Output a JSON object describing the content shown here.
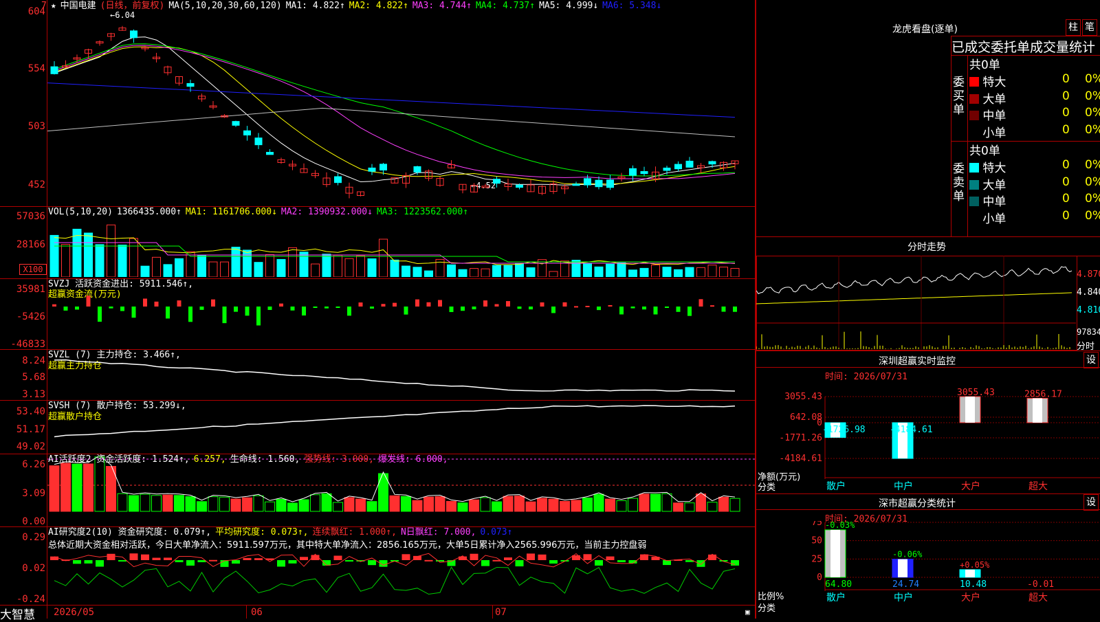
{
  "header": {
    "marker": "7",
    "star": "★",
    "stock_name": "中国电建",
    "period": "(日线，前复权)",
    "ma_label": "MA(5,10,20,30,60,120)",
    "ma1": "MA1: 4.822↑",
    "ma2": "MA2: 4.822↑",
    "ma3": "MA3: 4.744↑",
    "ma4": "MA4: 4.737↑",
    "ma5": "MA5: 4.999↓",
    "ma6": "MA6: 5.348↓",
    "high_note": "6.04",
    "low_note": "4.52"
  },
  "price_axis": [
    "604",
    "554",
    "503",
    "452"
  ],
  "vol": {
    "title": "VOL(5,10,20)",
    "value": "1366435.000↑",
    "ma1": "MA1: 1161706.000↓",
    "ma2": "MA2: 1390932.000↓",
    "ma3": "MA3: 1223562.000↑",
    "axis": [
      "57036",
      "28166"
    ],
    "unit": "X100"
  },
  "svzj": {
    "title": "SVZJ  活跃资金进出: 5911.546↑,",
    "subtitle": "超赢资金流(万元)",
    "axis": [
      "35981",
      "-5426",
      "-46833"
    ]
  },
  "svzl": {
    "title": "SVZL (7) 主力持仓: 3.466↑,",
    "subtitle": "超赢主力持仓",
    "axis": [
      "8.24",
      "5.68",
      "3.13"
    ]
  },
  "svsh": {
    "title": "SVSH (7) 散户持仓: 53.299↓,",
    "subtitle": "超赢散户持仓",
    "axis": [
      "53.40",
      "51.17",
      "49.02"
    ]
  },
  "ai1": {
    "title": "AI活跃度2 资金活跃度: 1.524↑,",
    "v2": "6.257,",
    "life": "生命线: 1.560,",
    "strong": "强势线: 3.000,",
    "burst": "爆发线: 6.000,",
    "axis": [
      "6.26",
      "3.09",
      "0.00"
    ]
  },
  "ai2": {
    "title": "AI研究度2(10) 资金研究度: 0.079↑,",
    "avg": "平均研究度: 0.073↑,",
    "cont": "连续飘红: 1.000↑,",
    "nday": "N日飘红: 7.000,",
    "last": "0.073↑",
    "summary": "总体近期大资金相对活跃，今日大单净流入：5911.597万元，其中特大单净流入：2856.165万元，大单5日累计净入2565.996万元，当前主力控盘弱",
    "axis": [
      "0.29",
      "0.02",
      "-0.24"
    ]
  },
  "bottom": {
    "brand": "大智慧",
    "dates": [
      "2026/05",
      "06",
      "07"
    ]
  },
  "right": {
    "lhb_title": "龙虎看盘(逐单)",
    "btn_zhu": "柱",
    "btn_bi": "笔",
    "stat_title": "已成交委托单成交量统计",
    "buy_label": "委买单",
    "sell_label": "委卖单",
    "buy_total": "共0单",
    "sell_total": "共0单",
    "buy_rows": [
      {
        "name": "特大",
        "n": "0",
        "pct": "0%",
        "color": "#ff0000"
      },
      {
        "name": "大单",
        "n": "0",
        "pct": "0%",
        "color": "#a00000"
      },
      {
        "name": "中单",
        "n": "0",
        "pct": "0%",
        "color": "#700000"
      },
      {
        "name": "小单",
        "n": "0",
        "pct": "0%",
        "color": "#000000"
      }
    ],
    "sell_rows": [
      {
        "name": "特大",
        "n": "0",
        "pct": "0%",
        "color": "#00ffff"
      },
      {
        "name": "大单",
        "n": "0",
        "pct": "0%",
        "color": "#008080"
      },
      {
        "name": "中单",
        "n": "0",
        "pct": "0%",
        "color": "#006060"
      },
      {
        "name": "小单",
        "n": "0",
        "pct": "0%",
        "color": "#000000"
      }
    ],
    "tick_title": "分时走势",
    "tick_axis": [
      "4.870",
      "4.840",
      "4.810"
    ],
    "tick_vol": "97834",
    "tick_vol_label": "分时",
    "sz_title": "深圳超赢实时监控",
    "sz_btn": "设",
    "sz_time": "时间: 2026/07/31",
    "sz_axis": [
      "3055.43",
      "642.08",
      "0",
      "-1771.26",
      "-4184.61"
    ],
    "sz_vals": [
      "-1726.98",
      "-4184.61",
      "3055.43",
      "2856.17"
    ],
    "sz_cats": [
      "散户",
      "中户",
      "大户",
      "超大"
    ],
    "sz_label1": "净额(万元)",
    "sz_label2": "分类",
    "cls_title": "深市超赢分类统计",
    "cls_btn": "设",
    "cls_time": "时间: 2026/07/31",
    "cls_axis": [
      "75",
      "50",
      "25",
      "0"
    ],
    "cls_vals": [
      "64.80",
      "24.74",
      "10.48",
      "-0.01"
    ],
    "cls_changes": [
      "-0.03%",
      "-0.06%",
      "+0.05%"
    ],
    "cls_cats": [
      "散户",
      "中户",
      "大户",
      "超大"
    ],
    "cls_label1": "比例%",
    "cls_label2": "分类"
  },
  "chart_data": [
    {
      "type": "candlestick",
      "title": "中国电建 (日线，前复权)",
      "ylim": [
        4.52,
        6.04
      ],
      "annotations": [
        "6.04",
        "4.52"
      ]
    },
    {
      "type": "bar",
      "title": "深圳超赢实时监控",
      "categories": [
        "散户",
        "中户",
        "大户",
        "超大"
      ],
      "values": [
        -1726.98,
        -4184.61,
        3055.43,
        2856.17
      ],
      "ylabel": "净额(万元)",
      "xlabel": "分类"
    },
    {
      "type": "bar",
      "title": "深市超赢分类统计",
      "categories": [
        "散户",
        "中户",
        "大户",
        "超大"
      ],
      "values": [
        64.8,
        24.74,
        10.48,
        -0.01
      ],
      "ylabel": "比例%",
      "xlabel": "分类",
      "ylim": [
        0,
        75
      ]
    }
  ]
}
